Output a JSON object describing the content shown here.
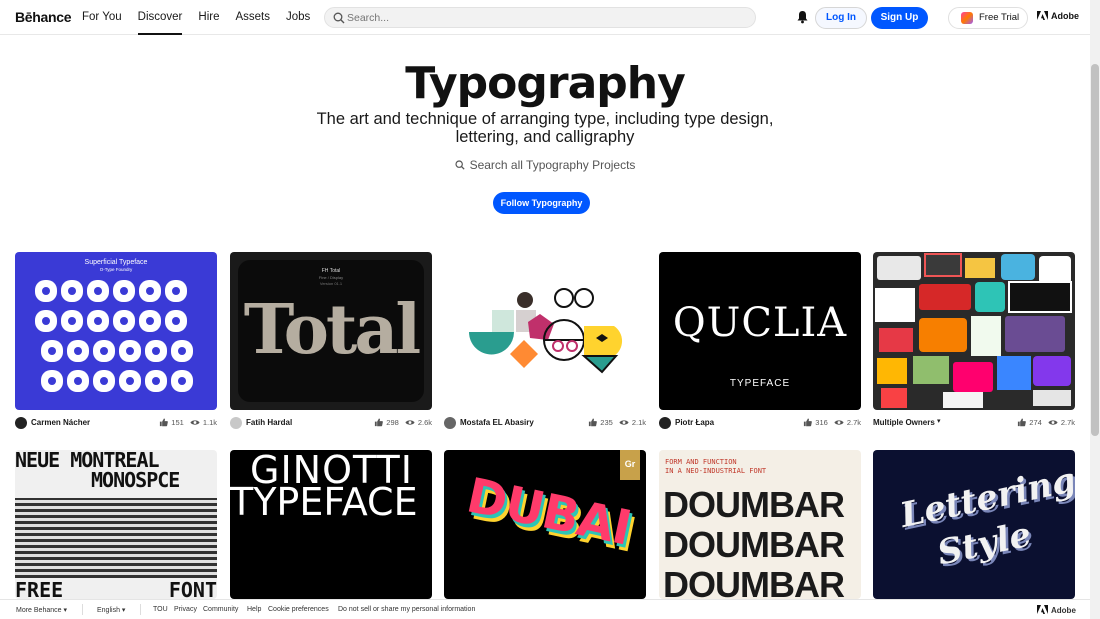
{
  "header": {
    "logo": "Bēhance",
    "nav": [
      "For You",
      "Discover",
      "Hire",
      "Assets",
      "Jobs"
    ],
    "search_placeholder": "Search...",
    "login": "Log In",
    "signup": "Sign Up",
    "trial": "Free Trial",
    "adobe": "Adobe",
    "accent": "#0057ff"
  },
  "hero": {
    "title": "Typography",
    "subtitle": "The art and technique of arranging type, including type design, lettering, and calligraphy",
    "search_text": "Search all Typography Projects",
    "follow": "Follow Typography"
  },
  "projects": [
    {
      "owner": "Carmen Nácher",
      "likes": "151",
      "views": "1.1k",
      "thumb_title": "Superficial Typeface",
      "thumb_sub": "O-Type Foundry"
    },
    {
      "owner": "Fatih Hardal",
      "likes": "298",
      "views": "2.6k",
      "thumb_title": "FH Total",
      "thumb_sub": "Fine / Display",
      "thumb_sub2": "Version 01.1",
      "thumb_word": "Total"
    },
    {
      "owner": "Mostafa EL Abasiry",
      "likes": "235",
      "views": "2.1k"
    },
    {
      "owner": "Piotr Łapa",
      "likes": "316",
      "views": "2.7k",
      "thumb_word": "QUCLIA",
      "thumb_sub": "TYPEFACE"
    },
    {
      "owner": "Multiple Owners",
      "likes": "274",
      "views": "2.7k"
    },
    {
      "thumb_word": "NEUE MONTREAL",
      "thumb_word2": "MONOSPCE",
      "thumb_word3": "FREE",
      "thumb_word4": "FONT"
    },
    {
      "thumb_word": "GINOTTI",
      "thumb_word2": "TYPEFACE"
    },
    {
      "thumb_word": "DUBAI",
      "badge": "Gr"
    },
    {
      "thumb_sub": "FORM AND FUNCTION",
      "thumb_sub2": "IN A NEO-INDUSTRIAL FONT",
      "thumb_word": "DOUMBAR"
    },
    {
      "thumb_word": "Lettering",
      "thumb_word2": "Style"
    }
  ],
  "footer": {
    "more": "More Behance",
    "language": "English",
    "links": [
      "TOU",
      "Privacy",
      "Community",
      "Help",
      "Cookie preferences",
      "Do not sell or share my personal information"
    ],
    "adobe": "Adobe"
  }
}
